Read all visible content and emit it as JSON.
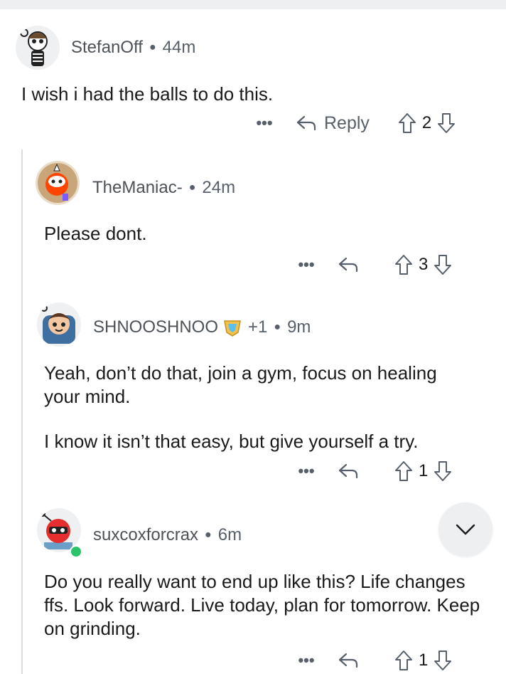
{
  "icons": {
    "more": "more-options-icon",
    "reply": "reply-arrow-icon",
    "upvote": "upvote-arrow-icon",
    "downvote": "downvote-arrow-icon",
    "collapse": "chevron-down-icon"
  },
  "colors": {
    "text": "#1a1a1b",
    "meta": "#57606a",
    "thread_line": "#dadcdf",
    "online": "#2bc46b"
  },
  "comments": [
    {
      "user": "StefanOff",
      "age": "44m",
      "paragraphs": [
        "I wish i had the balls to do this."
      ],
      "more": "•••",
      "reply_label": "Reply",
      "score": "2"
    },
    {
      "user": "TheManiac-",
      "age": "24m",
      "paragraphs": [
        "Please dont."
      ],
      "more": "•••",
      "score": "3"
    },
    {
      "user": "SHNOOSHNOO",
      "flair": "+1",
      "age": "9m",
      "paragraphs": [
        "Yeah, don’t do that, join a gym, focus on healing your mind.",
        "I know it isn’t that easy, but give yourself a try."
      ],
      "more": "•••",
      "score": "1"
    },
    {
      "user": "suxcoxforcrax",
      "age": "6m",
      "paragraphs": [
        "Do you really want to end up like this? Life changes ffs. Look forward. Live today, plan for tomorrow. Keep on grinding."
      ],
      "more": "•••",
      "score": "1"
    }
  ]
}
